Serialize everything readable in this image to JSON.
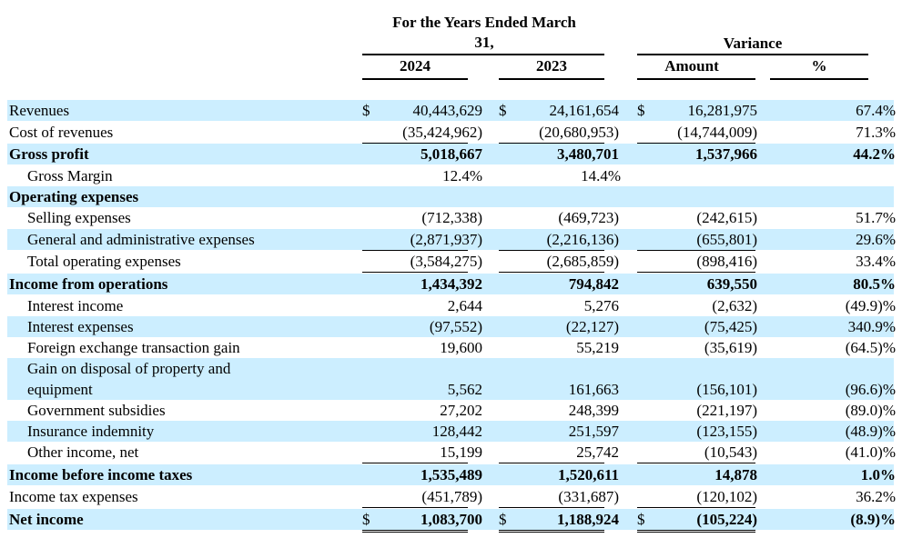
{
  "header": {
    "years_title_line1": "For the Years Ended March",
    "years_title_line2": "31,",
    "variance_title": "Variance",
    "col_2024": "2024",
    "col_2023": "2023",
    "col_amount": "Amount",
    "col_pct": "%"
  },
  "currency_symbol": "$",
  "rows": [
    {
      "label": "Revenues",
      "v2024": "40,443,629",
      "v2023": "24,161,654",
      "amount": "16,281,975",
      "pct": "67.4%"
    },
    {
      "label": "Cost of revenues",
      "v2024": "(35,424,962)",
      "v2023": "(20,680,953)",
      "amount": "(14,744,009)",
      "pct": "71.3%"
    },
    {
      "label": "Gross profit",
      "v2024": "5,018,667",
      "v2023": "3,480,701",
      "amount": "1,537,966",
      "pct": "44.2%"
    },
    {
      "label": "Gross Margin",
      "v2024": "12.4%",
      "v2023": "14.4%"
    },
    {
      "label": "Operating expenses"
    },
    {
      "label": "Selling expenses",
      "v2024": "(712,338)",
      "v2023": "(469,723)",
      "amount": "(242,615)",
      "pct": "51.7%"
    },
    {
      "label": "General and administrative expenses",
      "v2024": "(2,871,937)",
      "v2023": "(2,216,136)",
      "amount": "(655,801)",
      "pct": "29.6%"
    },
    {
      "label": "Total operating expenses",
      "v2024": "(3,584,275)",
      "v2023": "(2,685,859)",
      "amount": "(898,416)",
      "pct": "33.4%"
    },
    {
      "label": "Income from operations",
      "v2024": "1,434,392",
      "v2023": "794,842",
      "amount": "639,550",
      "pct": "80.5%"
    },
    {
      "label": "Interest income",
      "v2024": "2,644",
      "v2023": "5,276",
      "amount": "(2,632)",
      "pct": "(49.9)%"
    },
    {
      "label": "Interest expenses",
      "v2024": "(97,552)",
      "v2023": "(22,127)",
      "amount": "(75,425)",
      "pct": "340.9%"
    },
    {
      "label": "Foreign exchange transaction gain",
      "v2024": "19,600",
      "v2023": "55,219",
      "amount": "(35,619)",
      "pct": "(64.5)%"
    },
    {
      "label": "Gain on disposal of property and",
      "label2": "equipment",
      "v2024": "5,562",
      "v2023": "161,663",
      "amount": "(156,101)",
      "pct": "(96.6)%"
    },
    {
      "label": "Government subsidies",
      "v2024": "27,202",
      "v2023": "248,399",
      "amount": "(221,197)",
      "pct": "(89.0)%"
    },
    {
      "label": "Insurance indemnity",
      "v2024": "128,442",
      "v2023": "251,597",
      "amount": "(123,155)",
      "pct": "(48.9)%"
    },
    {
      "label": "Other income, net",
      "v2024": "15,199",
      "v2023": "25,742",
      "amount": "(10,543)",
      "pct": "(41.0)%"
    },
    {
      "label": "Income before income taxes",
      "v2024": "1,535,489",
      "v2023": "1,520,611",
      "amount": "14,878",
      "pct": "1.0%"
    },
    {
      "label": "Income tax expenses",
      "v2024": "(451,789)",
      "v2023": "(331,687)",
      "amount": "(120,102)",
      "pct": "36.2%"
    },
    {
      "label": "Net income",
      "v2024": "1,083,700",
      "v2023": "1,188,924",
      "amount": "(105,224)",
      "pct": "(8.9)%"
    }
  ]
}
